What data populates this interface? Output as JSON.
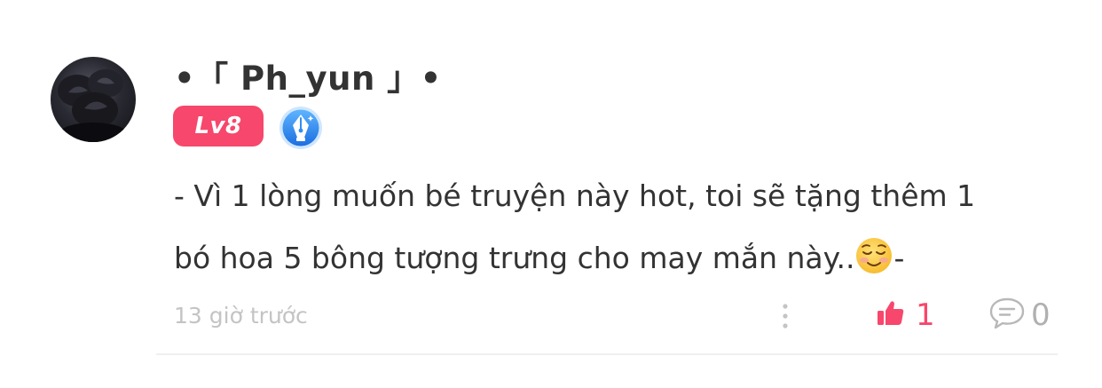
{
  "comment": {
    "username": "•「 Ph_yun 」•",
    "level": "Lv8",
    "badge_icon": "pen-nib-badge-icon",
    "text_line1": "- Vì 1 lòng muốn bé truyện này hot, toi sẽ tặng thêm 1",
    "text_line2": "bó hoa 5 bông tượng trưng cho may mắn này..",
    "text_suffix": "-",
    "emoji": "smiling-face-icon",
    "time": "13 giờ trước",
    "like_count": "1",
    "reply_count": "0"
  },
  "colors": {
    "accent": "#f7476c",
    "badge_blue": "#2f8ef0",
    "muted": "#c4c4c4"
  }
}
